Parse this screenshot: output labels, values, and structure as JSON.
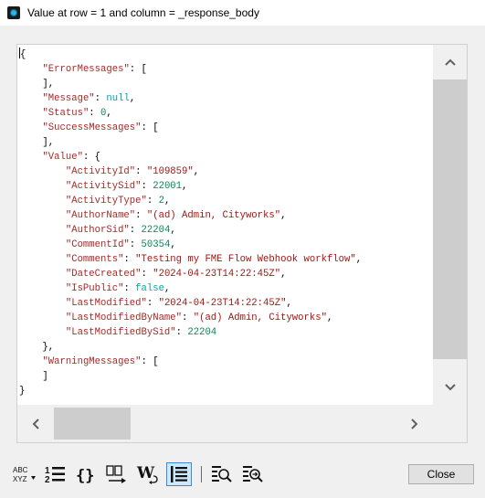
{
  "window": {
    "title": "Value at row = 1 and column = _response_body"
  },
  "code_lines": [
    [
      {
        "t": "{",
        "c": ""
      }
    ],
    [
      {
        "t": "    ",
        "c": ""
      },
      {
        "t": "\"ErrorMessages\"",
        "c": "k"
      },
      {
        "t": ": [",
        "c": ""
      }
    ],
    [
      {
        "t": "    ],",
        "c": ""
      }
    ],
    [
      {
        "t": "    ",
        "c": ""
      },
      {
        "t": "\"Message\"",
        "c": "k"
      },
      {
        "t": ": ",
        "c": ""
      },
      {
        "t": "null",
        "c": "b"
      },
      {
        "t": ",",
        "c": ""
      }
    ],
    [
      {
        "t": "    ",
        "c": ""
      },
      {
        "t": "\"Status\"",
        "c": "k"
      },
      {
        "t": ": ",
        "c": ""
      },
      {
        "t": "0",
        "c": "n"
      },
      {
        "t": ",",
        "c": ""
      }
    ],
    [
      {
        "t": "    ",
        "c": ""
      },
      {
        "t": "\"SuccessMessages\"",
        "c": "k"
      },
      {
        "t": ": [",
        "c": ""
      }
    ],
    [
      {
        "t": "    ],",
        "c": ""
      }
    ],
    [
      {
        "t": "    ",
        "c": ""
      },
      {
        "t": "\"Value\"",
        "c": "k"
      },
      {
        "t": ": {",
        "c": ""
      }
    ],
    [
      {
        "t": "        ",
        "c": ""
      },
      {
        "t": "\"ActivityId\"",
        "c": "k"
      },
      {
        "t": ": ",
        "c": ""
      },
      {
        "t": "\"109859\"",
        "c": "s"
      },
      {
        "t": ",",
        "c": ""
      }
    ],
    [
      {
        "t": "        ",
        "c": ""
      },
      {
        "t": "\"ActivitySid\"",
        "c": "k"
      },
      {
        "t": ": ",
        "c": ""
      },
      {
        "t": "22001",
        "c": "n"
      },
      {
        "t": ",",
        "c": ""
      }
    ],
    [
      {
        "t": "        ",
        "c": ""
      },
      {
        "t": "\"ActivityType\"",
        "c": "k"
      },
      {
        "t": ": ",
        "c": ""
      },
      {
        "t": "2",
        "c": "n"
      },
      {
        "t": ",",
        "c": ""
      }
    ],
    [
      {
        "t": "        ",
        "c": ""
      },
      {
        "t": "\"AuthorName\"",
        "c": "k"
      },
      {
        "t": ": ",
        "c": ""
      },
      {
        "t": "\"(ad) Admin, Cityworks\"",
        "c": "s"
      },
      {
        "t": ",",
        "c": ""
      }
    ],
    [
      {
        "t": "        ",
        "c": ""
      },
      {
        "t": "\"AuthorSid\"",
        "c": "k"
      },
      {
        "t": ": ",
        "c": ""
      },
      {
        "t": "22204",
        "c": "n"
      },
      {
        "t": ",",
        "c": ""
      }
    ],
    [
      {
        "t": "        ",
        "c": ""
      },
      {
        "t": "\"CommentId\"",
        "c": "k"
      },
      {
        "t": ": ",
        "c": ""
      },
      {
        "t": "50354",
        "c": "n"
      },
      {
        "t": ",",
        "c": ""
      }
    ],
    [
      {
        "t": "        ",
        "c": ""
      },
      {
        "t": "\"Comments\"",
        "c": "k"
      },
      {
        "t": ": ",
        "c": ""
      },
      {
        "t": "\"Testing my FME Flow Webhook workflow\"",
        "c": "s"
      },
      {
        "t": ",",
        "c": ""
      }
    ],
    [
      {
        "t": "        ",
        "c": ""
      },
      {
        "t": "\"DateCreated\"",
        "c": "k"
      },
      {
        "t": ": ",
        "c": ""
      },
      {
        "t": "\"2024-04-23T14:22:45Z\"",
        "c": "s"
      },
      {
        "t": ",",
        "c": ""
      }
    ],
    [
      {
        "t": "        ",
        "c": ""
      },
      {
        "t": "\"IsPublic\"",
        "c": "k"
      },
      {
        "t": ": ",
        "c": ""
      },
      {
        "t": "false",
        "c": "b"
      },
      {
        "t": ",",
        "c": ""
      }
    ],
    [
      {
        "t": "        ",
        "c": ""
      },
      {
        "t": "\"LastModified\"",
        "c": "k"
      },
      {
        "t": ": ",
        "c": ""
      },
      {
        "t": "\"2024-04-23T14:22:45Z\"",
        "c": "s"
      },
      {
        "t": ",",
        "c": ""
      }
    ],
    [
      {
        "t": "        ",
        "c": ""
      },
      {
        "t": "\"LastModifiedByName\"",
        "c": "k"
      },
      {
        "t": ": ",
        "c": ""
      },
      {
        "t": "\"(ad) Admin, Cityworks\"",
        "c": "s"
      },
      {
        "t": ",",
        "c": ""
      }
    ],
    [
      {
        "t": "        ",
        "c": ""
      },
      {
        "t": "\"LastModifiedBySid\"",
        "c": "k"
      },
      {
        "t": ": ",
        "c": ""
      },
      {
        "t": "22204",
        "c": "n"
      }
    ],
    [
      {
        "t": "    },",
        "c": ""
      }
    ],
    [
      {
        "t": "    ",
        "c": ""
      },
      {
        "t": "\"WarningMessages\"",
        "c": "k"
      },
      {
        "t": ": [",
        "c": ""
      }
    ],
    [
      {
        "t": "    ]",
        "c": ""
      }
    ],
    [
      {
        "t": "}",
        "c": ""
      }
    ]
  ],
  "toolbar": {
    "sort_text_top": "ABC",
    "sort_text_bottom": "XYZ",
    "line_numbers_text_top": "1",
    "line_numbers_text_bottom": "2",
    "format_json_text": "{}",
    "wrap_text": "W"
  },
  "buttons": {
    "close_label": "Close"
  },
  "colors": {
    "key": "#a52a2a",
    "string": "#a31515",
    "number": "#098658",
    "literal": "#0aa3a3",
    "active_button_bg": "#cce8ff",
    "active_button_border": "#3a8ad6"
  },
  "icons": [
    "app-icon",
    "scroll-up-icon",
    "scroll-down-icon",
    "scroll-left-icon",
    "scroll-right-icon",
    "sort-icon",
    "line-numbers-icon",
    "format-json-icon",
    "open-external-icon",
    "word-wrap-icon",
    "whitespace-icon",
    "find-icon",
    "find-next-icon"
  ]
}
